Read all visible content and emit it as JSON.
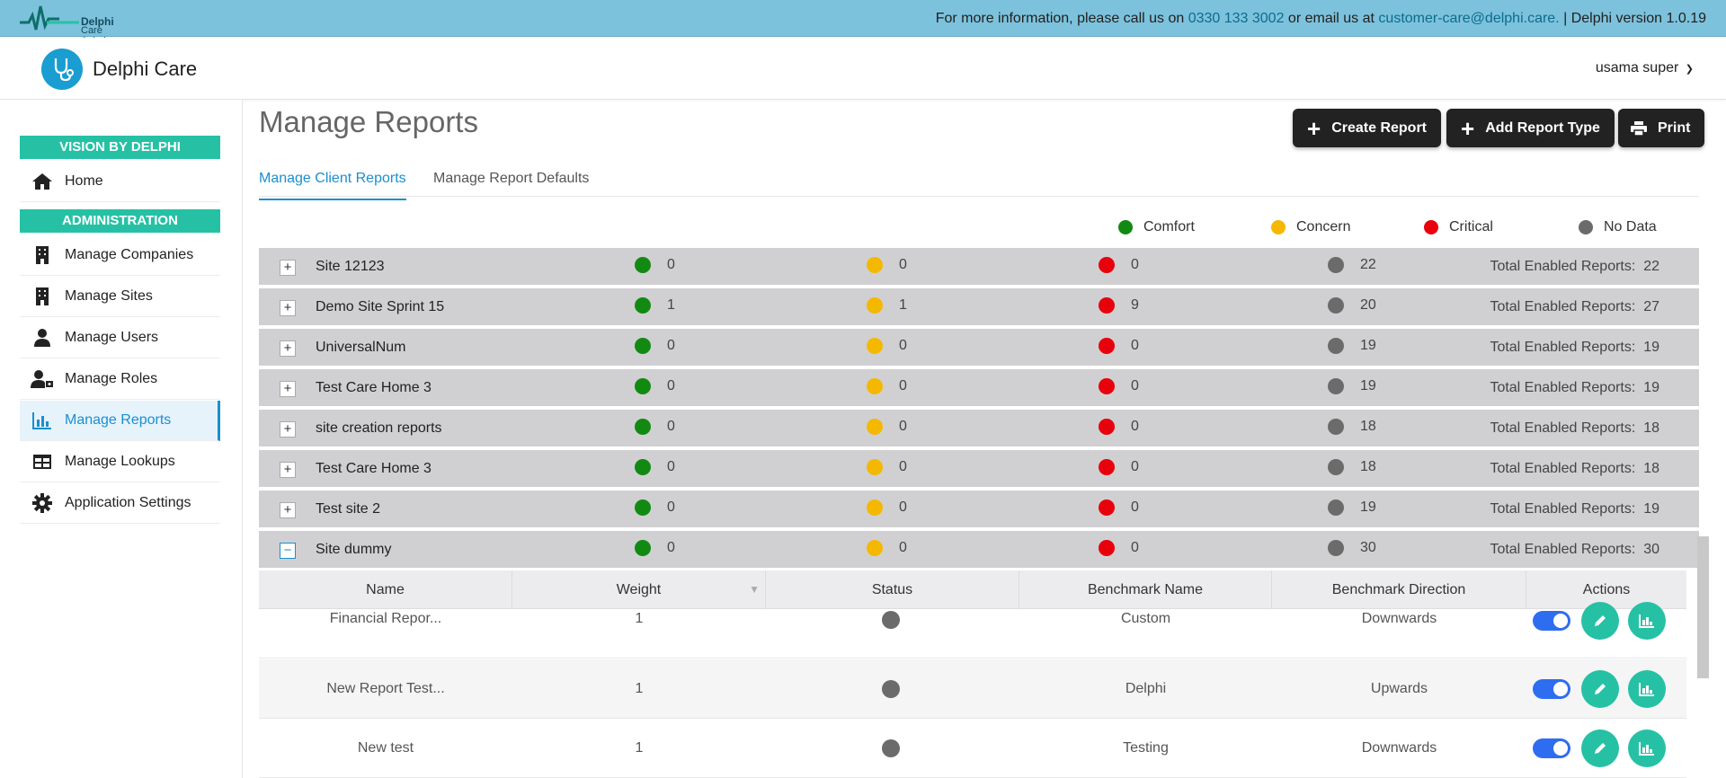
{
  "topbar": {
    "logo_line1": "Delphi",
    "logo_line2": "Care Solutions",
    "info_prefix": "For more information, please call us on ",
    "phone": "0330 133 3002",
    "info_mid": " or email us at ",
    "email": "customer-care@delphi.care.",
    "info_suffix": " | Delphi version 1.0.19"
  },
  "header": {
    "app_name": "Delphi Care",
    "user_name": "usama super"
  },
  "sidebar": {
    "section1": "VISION BY DELPHI",
    "home": "Home",
    "section2": "ADMINISTRATION",
    "items": [
      {
        "label": "Manage Companies",
        "icon": "building-icon"
      },
      {
        "label": "Manage Sites",
        "icon": "building-icon"
      },
      {
        "label": "Manage Users",
        "icon": "user-icon"
      },
      {
        "label": "Manage Roles",
        "icon": "user-tag-icon"
      },
      {
        "label": "Manage Reports",
        "icon": "chart-icon"
      },
      {
        "label": "Manage Lookups",
        "icon": "table-icon"
      },
      {
        "label": "Application Settings",
        "icon": "gear-icon"
      }
    ]
  },
  "main": {
    "title": "Manage Reports",
    "buttons": {
      "create": "Create Report",
      "add_type": "Add Report Type",
      "print": "Print"
    },
    "tabs": [
      "Manage Client Reports",
      "Manage Report Defaults"
    ],
    "legend": [
      "Comfort",
      "Concern",
      "Critical",
      "No Data"
    ],
    "total_label": "Total Enabled Reports:",
    "sites": [
      {
        "name": "Site 12123",
        "comfort": "0",
        "concern": "0",
        "critical": "0",
        "nodata": "22",
        "total": "22"
      },
      {
        "name": "Demo Site Sprint 15",
        "comfort": "1",
        "concern": "1",
        "critical": "9",
        "nodata": "20",
        "total": "27"
      },
      {
        "name": "UniversalNum",
        "comfort": "0",
        "concern": "0",
        "critical": "0",
        "nodata": "19",
        "total": "19"
      },
      {
        "name": "Test Care Home 3",
        "comfort": "0",
        "concern": "0",
        "critical": "0",
        "nodata": "19",
        "total": "19"
      },
      {
        "name": "site creation reports",
        "comfort": "0",
        "concern": "0",
        "critical": "0",
        "nodata": "18",
        "total": "18"
      },
      {
        "name": "Test Care Home 3",
        "comfort": "0",
        "concern": "0",
        "critical": "0",
        "nodata": "18",
        "total": "18"
      },
      {
        "name": "Test site 2",
        "comfort": "0",
        "concern": "0",
        "critical": "0",
        "nodata": "19",
        "total": "19"
      },
      {
        "name": "Site dummy",
        "comfort": "0",
        "concern": "0",
        "critical": "0",
        "nodata": "30",
        "total": "30"
      }
    ],
    "expand_symbol": "+",
    "collapse_symbol": "−",
    "sub_table": {
      "columns": [
        "Name",
        "Weight",
        "Status",
        "Benchmark Name",
        "Benchmark Direction",
        "Actions"
      ],
      "rows": [
        {
          "name": "Financial Repor...",
          "weight": "1",
          "benchmark": "Custom",
          "direction": "Downwards"
        },
        {
          "name": "New Report Test...",
          "weight": "1",
          "benchmark": "Delphi",
          "direction": "Upwards"
        },
        {
          "name": "New test",
          "weight": "1",
          "benchmark": "Testing",
          "direction": "Downwards"
        }
      ]
    }
  },
  "colors": {
    "comfort": "#128a12",
    "concern": "#f5b800",
    "critical": "#e8000c",
    "nodata": "#6b6b6b",
    "accent": "#1a8fd0",
    "teal": "#26c1a5"
  }
}
